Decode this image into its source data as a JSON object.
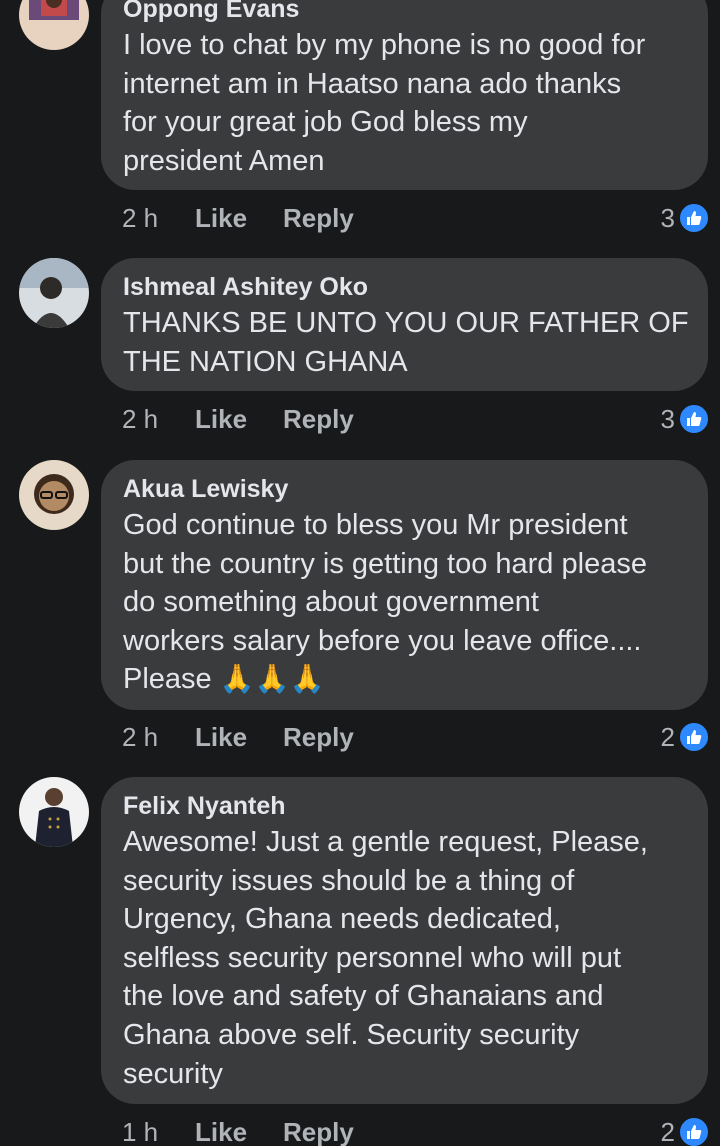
{
  "comments": [
    {
      "name": "Oppong Evans",
      "text": "I love to chat by my phone is no good for\ninternet am in Haatso nana ado thanks\nfor your great job God bless my\npresident Amen",
      "time": "2 h",
      "like_label": "Like",
      "reply_label": "Reply",
      "reactions": "3",
      "avatar_colors": [
        "#6b4a7a",
        "#c24a4a",
        "#e8d2c0"
      ]
    },
    {
      "name": "Ishmeal Ashitey Oko",
      "text": "THANKS BE UNTO YOU OUR FATHER OF\nTHE NATION GHANA",
      "time": "2 h",
      "like_label": "Like",
      "reply_label": "Reply",
      "reactions": "3",
      "avatar_colors": [
        "#a9b7c4",
        "#3a3a3a",
        "#d8dde2"
      ]
    },
    {
      "name": "Akua Lewisky",
      "text": "God continue to bless you Mr president\nbut the country is getting too hard please\ndo something about government\nworkers salary before you leave office....\nPlease",
      "emoji": "🙏🙏🙏",
      "time": "2 h",
      "like_label": "Like",
      "reply_label": "Reply",
      "reactions": "2",
      "avatar_colors": [
        "#b28a63",
        "#3e2a1d",
        "#e7d9c8"
      ]
    },
    {
      "name": "Felix Nyanteh",
      "text": "Awesome! Just a gentle request, Please,\nsecurity issues should be a thing of\nUrgency, Ghana needs dedicated,\nselfless security personnel who will put\nthe love and safety of Ghanaians and\nGhana above self. Security security\nsecurity",
      "time": "1 h",
      "like_label": "Like",
      "reply_label": "Reply",
      "reactions": "2",
      "avatar_colors": [
        "#f2f2f2",
        "#1e2230",
        "#5a4030"
      ]
    }
  ],
  "theme": {
    "background": "#18191a",
    "bubble": "#3a3b3c",
    "like_blue": "#2e89ff"
  }
}
